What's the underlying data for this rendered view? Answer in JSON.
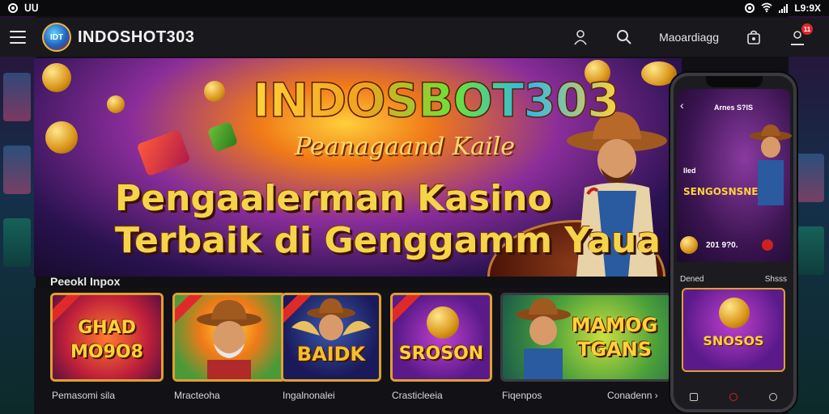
{
  "status_bar": {
    "left_text": "ᑌᑌ",
    "time": "L9:9X"
  },
  "header": {
    "brand": "INDOSHOT303",
    "logo_text": "IDT",
    "link": "Maoardiagg",
    "notification_count": "11",
    "icons": [
      "hamburger-icon",
      "user-icon",
      "search-icon",
      "bag-icon",
      "account-icon"
    ]
  },
  "hero": {
    "title": "INDOSBOT303",
    "subtitle": "Peanagaand Kaile",
    "headline_line1": "Pengaalerman Kasino",
    "headline_line2": "Terbaik di Genggamm Yaua"
  },
  "games_section": {
    "title": "Peeokl Inpox",
    "games": [
      {
        "art_text": "GHAD MO9O8",
        "name": "Pemasomi sila"
      },
      {
        "art_text": "",
        "name": "Mracteoha"
      },
      {
        "art_text": "BAIDK",
        "name": "Ingalnonalei"
      },
      {
        "art_text": "SROSON",
        "name": "Crasticleeia"
      },
      {
        "art_text": "MAMOG TGANS",
        "name": "Fiqenpos"
      }
    ],
    "more_label": "Conadenn"
  },
  "phone": {
    "title": "Arnes S?IS",
    "small_label": "Iled",
    "hero_text": "SENGOSNSNE",
    "amount": "201 9?0.",
    "row_left": "Dened",
    "row_right": "Shsss",
    "card_text": "SNOSOS"
  },
  "colors": {
    "accent": "#f2b632",
    "brand_bg": "#19191d",
    "notif": "#e0262c"
  }
}
